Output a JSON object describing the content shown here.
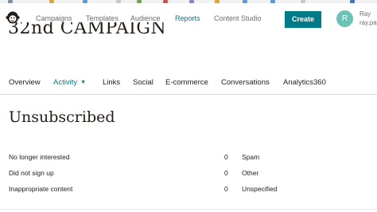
{
  "bookmarks_bar": {
    "colors": [
      "#7b8fa6",
      "#e2a13a",
      "#5a9bd5",
      "#c8c8c8",
      "#6aa84f",
      "#d05050",
      "#9a7bd0",
      "#e2a13a",
      "#5a9bd5",
      "#5a9bd5",
      "#c8c8c8",
      "#3a78c2"
    ]
  },
  "nav": {
    "logo_icon": "mailchimp-freddie-icon",
    "items": [
      {
        "label": "Campaigns",
        "active": false
      },
      {
        "label": "Templates",
        "active": false
      },
      {
        "label": "Audience",
        "active": false
      },
      {
        "label": "Reports",
        "active": true
      },
      {
        "label": "Content Studio",
        "active": false
      }
    ],
    "create_label": "Create",
    "avatar_initial": "R",
    "user_name": "Ray",
    "user_email": "ray.pa"
  },
  "campaign": {
    "title": "32nd CAMPAIGN"
  },
  "tabs": [
    {
      "label": "Overview",
      "active": false
    },
    {
      "label": "Activity",
      "active": true,
      "has_dropdown": true
    },
    {
      "label": "Links",
      "active": false
    },
    {
      "label": "Social",
      "active": false
    },
    {
      "label": "E-commerce",
      "active": false
    },
    {
      "label": "Conversations",
      "active": false
    },
    {
      "label": "Analytics360",
      "active": false
    }
  ],
  "unsubscribed": {
    "title": "Unsubscribed",
    "left_rows": [
      {
        "label": "No longer interested",
        "value": "0"
      },
      {
        "label": "Did not sign up",
        "value": "0"
      },
      {
        "label": "Inappropriate content",
        "value": "0"
      }
    ],
    "right_rows": [
      {
        "label": "Spam"
      },
      {
        "label": "Other"
      },
      {
        "label": "Unspecified"
      }
    ]
  },
  "colors": {
    "accent": "#007c89",
    "text": "#241c15",
    "muted": "#6b6b6b",
    "avatar": "#6cc3b5"
  }
}
